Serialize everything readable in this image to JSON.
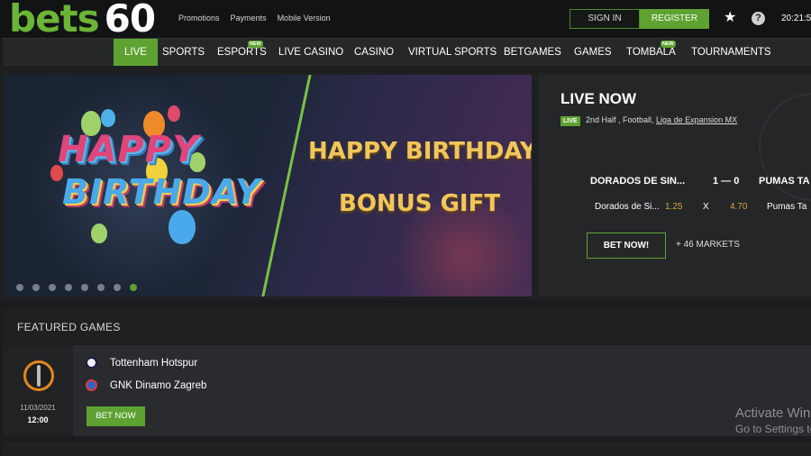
{
  "brand": {
    "name": "bets",
    "number": "60"
  },
  "top_links": [
    "Promotions",
    "Payments",
    "Mobile Version"
  ],
  "auth": {
    "signin": "SIGN IN",
    "register": "REGISTER"
  },
  "clock": "20:21:5",
  "nav": {
    "items": [
      "LIVE",
      "SPORTS",
      "ESPORTS",
      "LIVE CASINO",
      "CASINO",
      "VIRTUAL SPORTS",
      "BETGAMES",
      "GAMES",
      "TOMBALA",
      "TOURNAMENTS"
    ],
    "active": "LIVE",
    "new_badge": "NEW"
  },
  "banner": {
    "art_line1": "HAPPY",
    "art_line2": "BIRTHDAY",
    "title": "HAPPY BIRTHDAY",
    "subtitle": "BONUS GIFT",
    "slide_count": 8,
    "active_slide": 8
  },
  "live_now": {
    "title": "LIVE NOW",
    "badge": "LIVE",
    "info_prefix": "2nd Half , Football, ",
    "league": "Liga de Expansion MX",
    "home": "DORADOS DE SIN...",
    "away": "PUMAS TA",
    "score": "1 — 0",
    "odds": {
      "home_label": "Dorados de Si...",
      "home_odd": "1.25",
      "draw_label": "X",
      "draw_odd": "4.70",
      "away_label": "Pumas Ta"
    },
    "bet_now": "BET NOW!",
    "markets": "+ 46 MARKETS"
  },
  "featured": {
    "heading": "FEATURED GAMES",
    "game": {
      "date": "11/03/2021",
      "time": "12:00",
      "team1": "Tottenham Hotspur",
      "team2": "GNK Dinamo Zagreb",
      "bet_now": "BET NOW"
    }
  },
  "watermark": {
    "line1": "Activate Win",
    "line2": "Go to Settings to"
  },
  "colors": {
    "brand_green": "#5ea332",
    "odds_gold": "#d6a53c",
    "banner_gold": "#f1c65b"
  }
}
